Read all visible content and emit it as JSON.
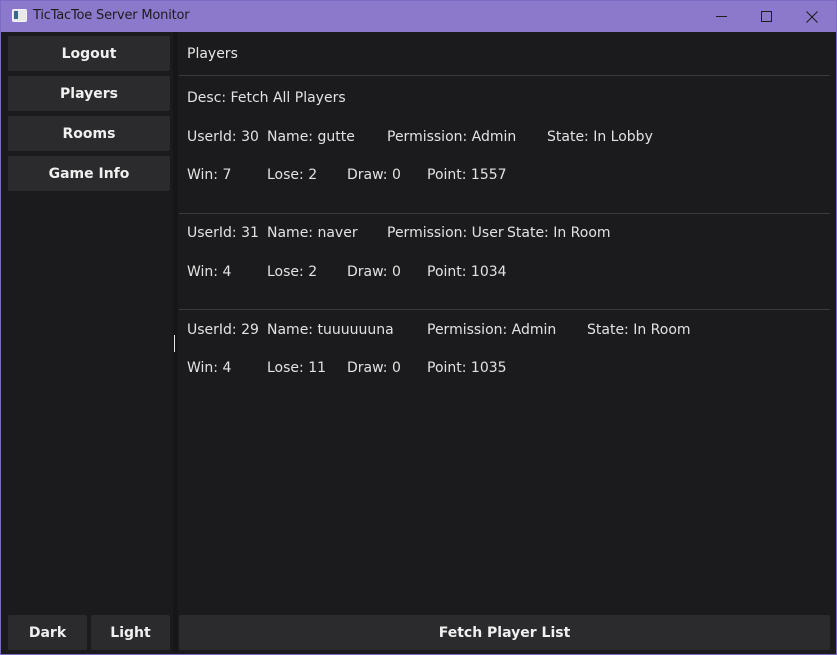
{
  "window": {
    "title": "TicTacToe Server Monitor"
  },
  "sidebar": {
    "items": [
      {
        "label": "Logout"
      },
      {
        "label": "Players"
      },
      {
        "label": "Rooms"
      },
      {
        "label": "Game Info"
      }
    ],
    "theme": {
      "dark": "Dark",
      "light": "Light"
    }
  },
  "main": {
    "header": "Players",
    "desc": "Desc: Fetch All Players",
    "players": [
      {
        "userid": "UserId: 30",
        "name": "Name: gutte",
        "permission": "Permission: Admin",
        "state": "State: In Lobby",
        "win": "Win: 7",
        "lose": "Lose: 2",
        "draw": "Draw: 0",
        "point": "Point: 1557"
      },
      {
        "userid": "UserId: 31",
        "name": "Name: naver",
        "permission": "Permission: User",
        "state": "State: In Room",
        "win": "Win: 4",
        "lose": "Lose: 2",
        "draw": "Draw: 0",
        "point": "Point: 1034"
      },
      {
        "userid": "UserId: 29",
        "name": "Name: tuuuuuuna",
        "permission": "Permission: Admin",
        "state": "State: In Room",
        "win": "Win: 4",
        "lose": "Lose: 11",
        "draw": "Draw: 0",
        "point": "Point: 1035"
      }
    ],
    "fetch_button": "Fetch Player List"
  }
}
